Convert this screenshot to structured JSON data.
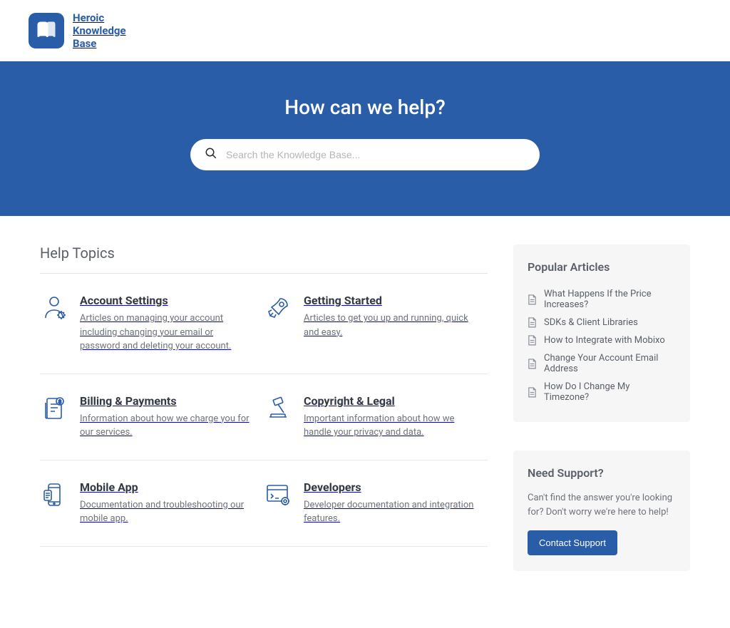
{
  "brand": {
    "line1": "Heroic",
    "line2": "Knowledge",
    "line3": "Base"
  },
  "hero": {
    "title": "How can we help?",
    "search_placeholder": "Search the Knowledge Base..."
  },
  "help_topics_heading": "Help Topics",
  "topics": [
    {
      "title": "Account Settings",
      "desc": "Articles on managing your account including changing your email or password and deleting your account."
    },
    {
      "title": "Getting Started",
      "desc": "Articles to get you up and running, quick and easy."
    },
    {
      "title": "Billing & Payments",
      "desc": "Information about how we charge you for our services."
    },
    {
      "title": "Copyright & Legal",
      "desc": "Important information about how we handle your privacy and data."
    },
    {
      "title": "Mobile App",
      "desc": "Documentation and troubleshooting our mobile app."
    },
    {
      "title": "Developers",
      "desc": "Developer documentation and integration features."
    }
  ],
  "popular": {
    "heading": "Popular Articles",
    "items": [
      "What Happens If the Price Increases?",
      "SDKs & Client Libraries",
      "How to Integrate with Mobixo",
      "Change Your Account Email Address",
      "How Do I Change My Timezone?"
    ]
  },
  "support": {
    "heading": "Need Support?",
    "text": "Can't find the answer you're looking for? Don't worry we're here to help!",
    "button": "Contact Support"
  }
}
